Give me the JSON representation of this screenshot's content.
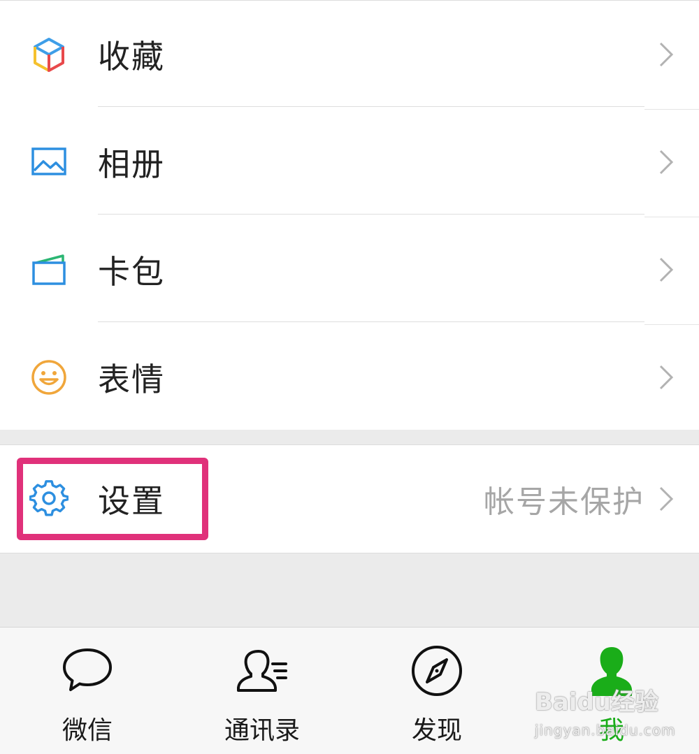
{
  "menu": {
    "items": [
      {
        "label": "收藏",
        "icon": "favorites-cube-icon"
      },
      {
        "label": "相册",
        "icon": "album-picture-icon"
      },
      {
        "label": "卡包",
        "icon": "card-wallet-icon"
      },
      {
        "label": "表情",
        "icon": "smiley-face-icon"
      }
    ],
    "settings": {
      "label": "设置",
      "icon": "gear-icon",
      "note": "帐号未保护"
    }
  },
  "tabbar": {
    "tabs": [
      {
        "label": "微信",
        "icon": "chat-bubble-icon"
      },
      {
        "label": "通讯录",
        "icon": "contacts-icon"
      },
      {
        "label": "发现",
        "icon": "compass-icon"
      },
      {
        "label": "我",
        "icon": "me-person-icon"
      }
    ],
    "active_index": 3
  },
  "watermark": {
    "line1": "Baidu经验",
    "line2": "jingyan.baidu.com"
  },
  "colors": {
    "accent_green": "#1aad19",
    "highlight_pink": "#e0317a",
    "chevron_gray": "#b2b2b2",
    "note_gray": "#a6a6a6"
  }
}
